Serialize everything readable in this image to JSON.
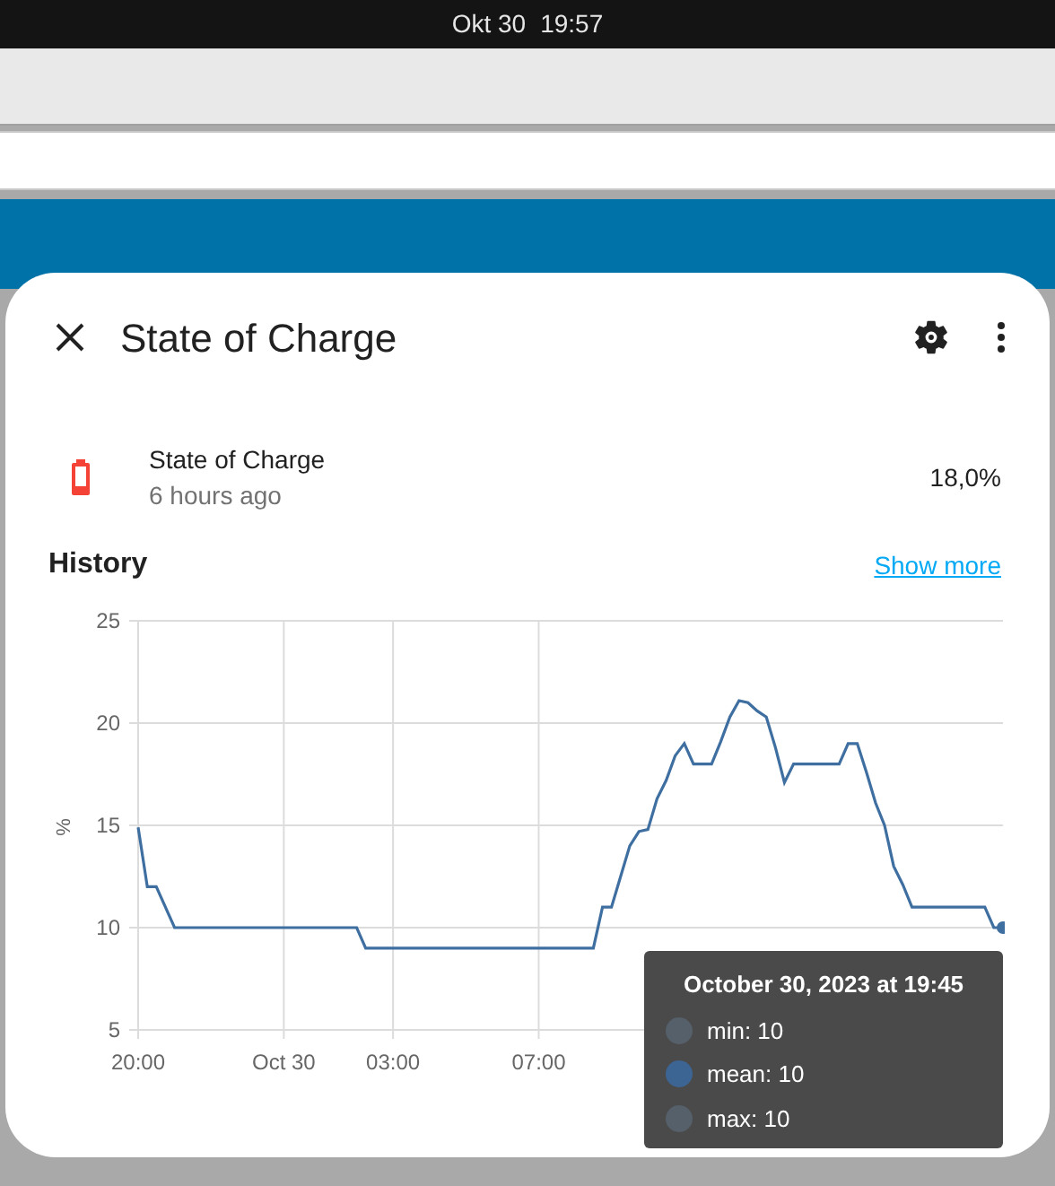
{
  "status_bar": {
    "date": "Okt 30",
    "time": "19:57"
  },
  "dialog": {
    "title": "State of Charge",
    "entity": {
      "name": "State of Charge",
      "last_changed": "6 hours ago",
      "value": "18,0%"
    },
    "history": {
      "heading": "History",
      "link": "Show more",
      "chart_data": {
        "type": "line",
        "grid": true,
        "ylabel": "%",
        "ylim": [
          5,
          25
        ],
        "yticks": [
          5,
          10,
          15,
          20,
          25
        ],
        "categories": [
          "20:00",
          null,
          null,
          null,
          null,
          null,
          null,
          null,
          null,
          null,
          null,
          null,
          null,
          null,
          null,
          null,
          "Oct 30",
          null,
          null,
          null,
          null,
          null,
          null,
          null,
          null,
          null,
          null,
          null,
          "03:00",
          null,
          null,
          null,
          null,
          null,
          null,
          null,
          null,
          null,
          null,
          null,
          null,
          null,
          null,
          null,
          "07:00",
          null,
          null,
          null,
          null,
          null,
          null,
          null,
          null,
          null,
          null,
          null,
          null,
          null,
          null,
          null,
          null,
          null,
          null,
          null,
          null,
          null,
          null,
          null,
          null,
          null,
          null,
          null,
          null,
          null,
          null,
          null,
          null,
          null,
          null,
          null,
          null,
          null,
          null,
          null,
          null,
          null,
          null,
          null,
          null,
          null,
          null,
          null,
          null,
          null,
          null,
          null
        ],
        "series": [
          {
            "color": "#3f6fa0",
            "values": [
              14.9,
              12,
              12,
              11,
              10,
              10,
              10,
              10,
              10,
              10,
              10,
              10,
              10,
              10,
              10,
              10,
              10,
              10,
              10,
              10,
              10,
              10,
              10,
              10,
              10,
              9,
              9,
              9,
              9,
              9,
              9,
              9,
              9,
              9,
              9,
              9,
              9,
              9,
              9,
              9,
              9,
              9,
              9,
              9,
              9,
              9,
              9,
              9,
              9,
              9,
              9,
              11,
              11,
              12.5,
              14,
              14.7,
              14.8,
              16.3,
              17.2,
              18.4,
              19,
              18,
              18,
              18,
              19.1,
              20.3,
              21.1,
              21,
              20.6,
              20.3,
              18.8,
              17.1,
              18,
              18,
              18,
              18,
              18,
              18,
              19,
              19,
              17.6,
              16.1,
              15,
              13,
              12.1,
              11,
              11,
              11,
              11,
              11,
              11,
              11,
              11,
              11,
              10,
              10
            ]
          }
        ]
      }
    },
    "tooltip": {
      "title": "October 30, 2023 at 19:45",
      "items": [
        {
          "label": "min: 10",
          "color": "#56606b"
        },
        {
          "label": "mean: 10",
          "color": "#3c6594"
        },
        {
          "label": "max: 10",
          "color": "#56606b"
        }
      ]
    }
  }
}
